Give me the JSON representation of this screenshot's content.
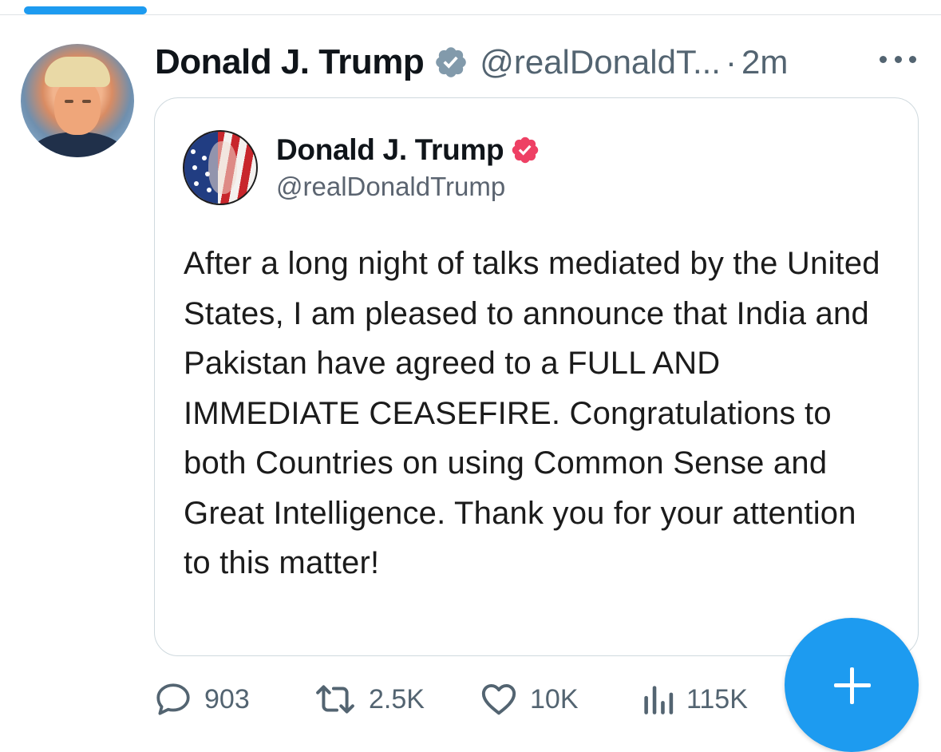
{
  "post": {
    "author_name": "Donald J. Trump",
    "author_handle": "@realDonaldT...",
    "separator": "·",
    "timestamp": "2m"
  },
  "quoted_post": {
    "author_name": "Donald J. Trump",
    "author_handle": "@realDonaldTrump",
    "body": "After a long night of talks mediated by the United States, I am pleased to announce that India and Pakistan have agreed to a FULL AND IMMEDIATE CEASEFIRE. Congratulations to both Countries on using Common Sense and Great Intelligence. Thank you for your attention to this matter!"
  },
  "actions": {
    "replies": "903",
    "reposts": "2.5K",
    "likes": "10K",
    "views": "115K"
  },
  "icons": {
    "verified": "verified-badge-icon",
    "more": "more-dots-icon",
    "reply": "reply-bubble-icon",
    "repost": "repost-arrows-icon",
    "like": "heart-icon",
    "views": "views-bar-chart-icon",
    "compose": "plus-icon"
  },
  "colors": {
    "accent": "#1d9bf0",
    "quoted_verified": "#ee4064",
    "verified_badge": "#829aab",
    "secondary_text": "#536471"
  }
}
